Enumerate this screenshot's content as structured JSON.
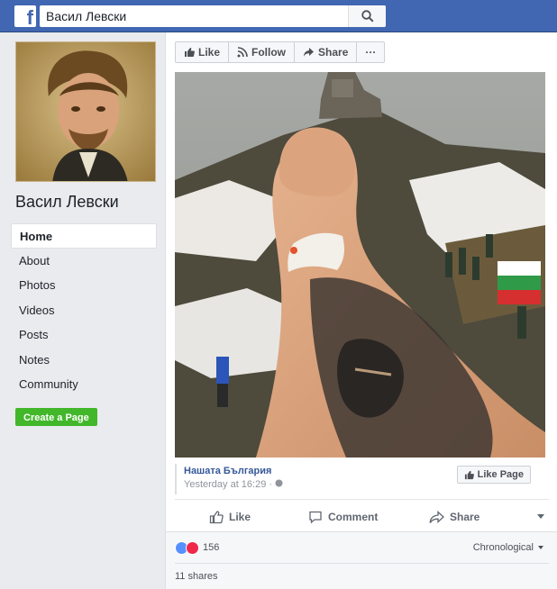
{
  "header": {
    "logo": "f",
    "search_value": "Васил Левски",
    "search_icon": "search-icon"
  },
  "sidebar": {
    "page_name": "Васил Левски",
    "nav": [
      "Home",
      "About",
      "Photos",
      "Videos",
      "Posts",
      "Notes",
      "Community"
    ],
    "active": "Home",
    "create_page": "Create a Page"
  },
  "actions": {
    "like": "Like",
    "follow": "Follow",
    "share": "Share",
    "more": "···"
  },
  "embed": {
    "source": "Нашата България",
    "time": "Yesterday at 16:29 ·",
    "like_page": "Like Page"
  },
  "post_actions": {
    "like": "Like",
    "comment": "Comment",
    "share": "Share"
  },
  "stats": {
    "reaction_count": "156",
    "sort": "Chronological",
    "shares": "11 shares"
  },
  "colors": {
    "brand": "#4267b2",
    "green": "#42b72a",
    "link": "#365899",
    "like_blue": "#5890ff",
    "love_red": "#f0284a"
  }
}
